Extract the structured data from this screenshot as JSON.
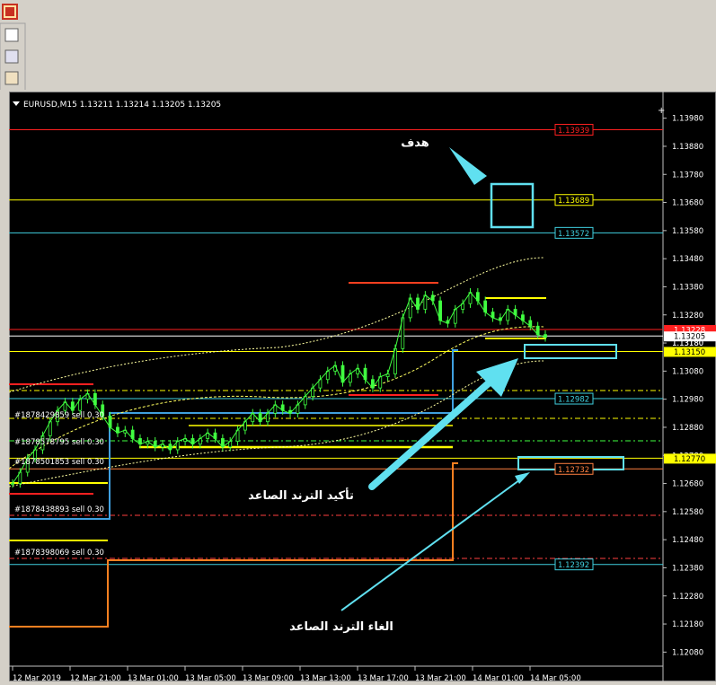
{
  "chart_title": "EURUSD,M15  1.13211 1.13214 1.13205 1.13205",
  "price_axis_ticks": [
    "1.13980",
    "1.13880",
    "1.13780",
    "1.13680",
    "1.13580",
    "1.13480",
    "1.13380",
    "1.13280",
    "1.13180",
    "1.13080",
    "1.12980",
    "1.12880",
    "1.12780",
    "1.12680",
    "1.12580",
    "1.12480",
    "1.12380",
    "1.12280",
    "1.12180",
    "1.12080"
  ],
  "time_axis_labels": [
    "12 Mar 2019",
    "12 Mar 21:00",
    "13 Mar 01:00",
    "13 Mar 05:00",
    "13 Mar 09:00",
    "13 Mar 13:00",
    "13 Mar 17:00",
    "13 Mar 21:00",
    "14 Mar 01:00",
    "14 Mar 05:00"
  ],
  "corner_marker": "+",
  "annotations": {
    "target": "هدف",
    "uptrend_confirmation": "تأكيد الترند الصاعد",
    "uptrend_cancellation": "الغاء الترند الصاعد"
  },
  "orders": [
    {
      "label": "#18784... sell 0.30",
      "text": "#1878429859 sell 0.30"
    },
    {
      "label": "#1878... sell 0.30",
      "text": "#1878578795 sell 0.30"
    },
    {
      "label": "#1878... sell 0.30",
      "text": "#1878501853 sell 0.30"
    },
    {
      "label": "#1878... sell 0.30",
      "text": "#1878438893 sell 0.30"
    },
    {
      "label": "#1878... sell 0.30",
      "text": "#1878398069 sell 0.30"
    }
  ],
  "chart_data": {
    "type": "line",
    "symbol": "EURUSD,M15",
    "ylim": [
      1.1203,
      1.1403
    ],
    "price_levels": [
      {
        "value": 1.13939,
        "label": "1.13939",
        "color": "#ff2020"
      },
      {
        "value": 1.13689,
        "label": "1.13689",
        "color": "#ffff00"
      },
      {
        "value": 1.13572,
        "label": "1.13572",
        "color": "#40d0e0"
      },
      {
        "value": 1.13228,
        "label": "1.13228",
        "color": "#ff2020"
      },
      {
        "value": 1.13205,
        "label": "1.13205",
        "color": "#ffffff"
      },
      {
        "value": 1.1315,
        "label": "1.13150",
        "color": "#ffff00"
      },
      {
        "value": 1.12982,
        "label": "1.12982",
        "color": "#40d0e0"
      },
      {
        "value": 1.1277,
        "label": "1.12770",
        "color": "#ffff00"
      },
      {
        "value": 1.12732,
        "label": "1.12732",
        "color": "#ff8040"
      },
      {
        "value": 1.12392,
        "label": "1.12392",
        "color": "#40d0e0"
      }
    ],
    "axis_extra_label": "1.13180",
    "close_series": [
      1.1268,
      1.1272,
      1.1277,
      1.128,
      1.1285,
      1.129,
      1.1294,
      1.1297,
      1.1294,
      1.1298,
      1.13,
      1.1296,
      1.1292,
      1.1288,
      1.1286,
      1.1287,
      1.1284,
      1.1282,
      1.1283,
      1.1281,
      1.1282,
      1.128,
      1.1283,
      1.1284,
      1.1282,
      1.1284,
      1.1286,
      1.1284,
      1.1281,
      1.1283,
      1.1287,
      1.129,
      1.1293,
      1.129,
      1.1293,
      1.1296,
      1.1294,
      1.1293,
      1.1296,
      1.1299,
      1.1302,
      1.1305,
      1.1308,
      1.131,
      1.1304,
      1.1307,
      1.1309,
      1.1305,
      1.1302,
      1.1306,
      1.1307,
      1.1316,
      1.1327,
      1.1334,
      1.133,
      1.1335,
      1.1333,
      1.1326,
      1.1325,
      1.133,
      1.1332,
      1.1336,
      1.1333,
      1.1329,
      1.1327,
      1.1326,
      1.133,
      1.1328,
      1.1326,
      1.1324,
      1.1321,
      1.132
    ]
  }
}
